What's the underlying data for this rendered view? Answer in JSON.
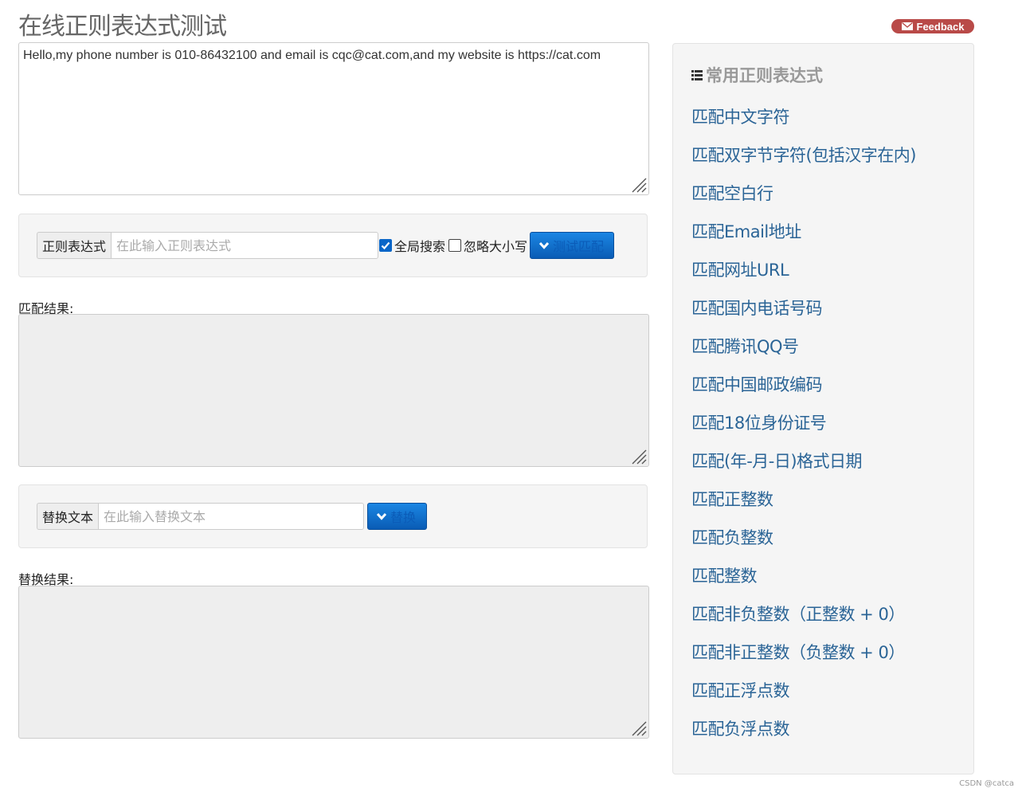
{
  "page": {
    "title": "在线正则表达式测试",
    "feedback_label": "Feedback"
  },
  "source": {
    "text": "Hello,my phone number is 010-86432100 and email is cqc@cat.com,and my website is https://cat.com"
  },
  "regex_form": {
    "addon_label": "正则表达式",
    "input_value": "",
    "input_placeholder": "在此输入正则表达式",
    "global_label": "全局搜索",
    "global_checked": true,
    "ignorecase_label": "忽略大小写",
    "ignorecase_checked": false,
    "test_button_label": "测试匹配"
  },
  "match_result": {
    "label": "匹配结果:",
    "value": ""
  },
  "replace_form": {
    "addon_label": "替换文本",
    "input_value": "",
    "input_placeholder": "在此输入替换文本",
    "replace_button_label": "替换"
  },
  "replace_result": {
    "label": "替换结果:",
    "value": ""
  },
  "sidebar": {
    "heading": "常用正则表达式",
    "items": [
      "匹配中文字符",
      "匹配双字节字符(包括汉字在内)",
      "匹配空白行",
      "匹配Email地址",
      "匹配网址URL",
      "匹配国内电话号码",
      "匹配腾讯QQ号",
      "匹配中国邮政编码",
      "匹配18位身份证号",
      "匹配(年-月-日)格式日期",
      "匹配正整数",
      "匹配负整数",
      "匹配整数",
      "匹配非负整数（正整数 + 0）",
      "匹配非正整数（负整数 + 0）",
      "匹配正浮点数",
      "匹配负浮点数"
    ]
  },
  "watermark": "CSDN @catca",
  "colors": {
    "link": "#2a6496",
    "primary_button": "#0a66c8",
    "feedback": "#b94a48",
    "well_background": "#f5f5f5",
    "readonly_background": "#eeeeee"
  },
  "icons": {
    "feedback": "envelope-icon",
    "heading": "list-icon",
    "buttons": "chevron-down-icon",
    "checkbox": "check-icon"
  }
}
